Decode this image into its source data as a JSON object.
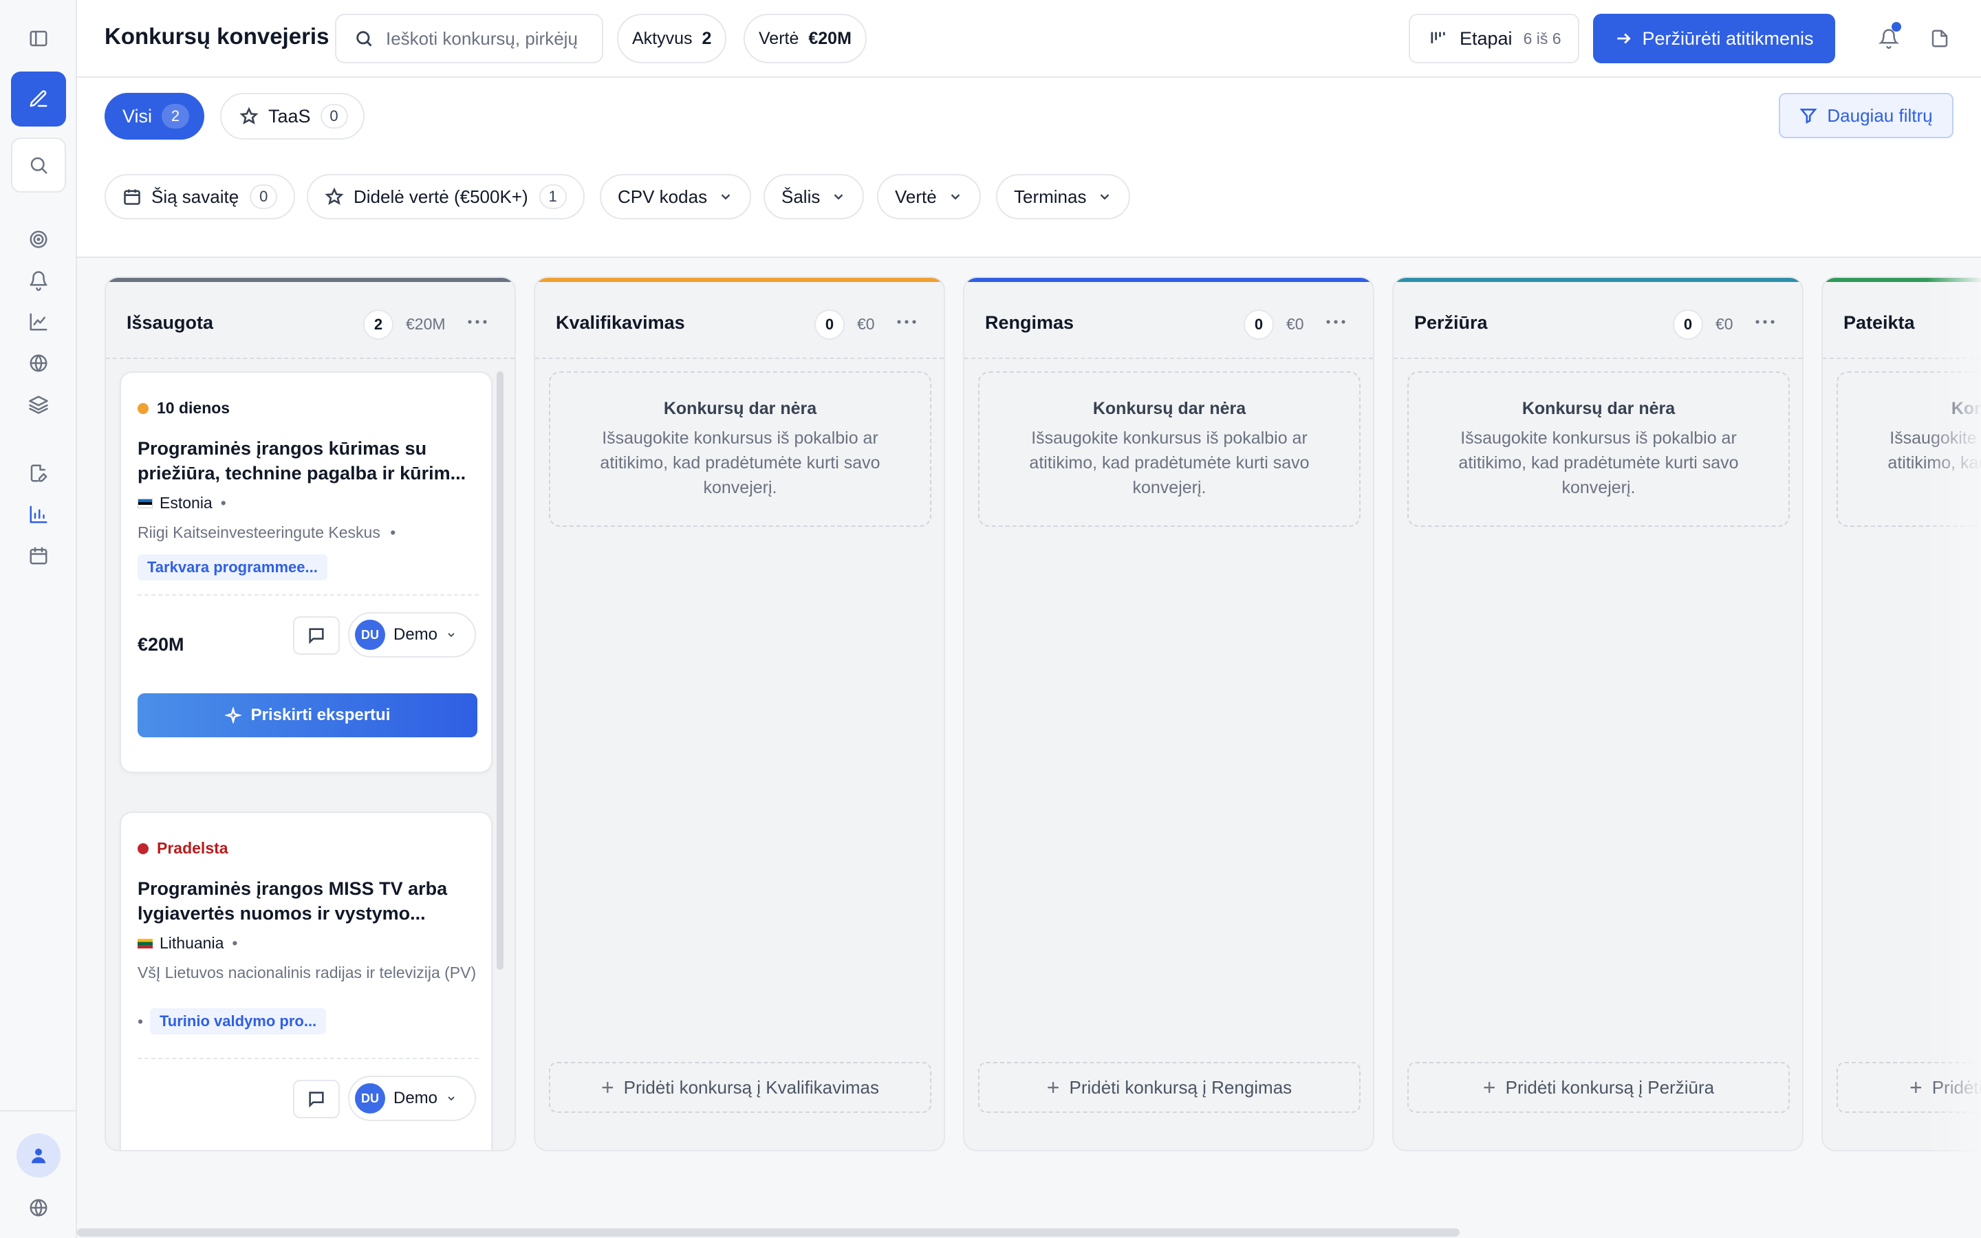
{
  "header": {
    "title": "Konkursų konvejeris",
    "search_placeholder": "Ieškoti konkursų, pirkėjų",
    "active_label": "Aktyvus",
    "active_count": "2",
    "value_label": "Vertė",
    "value_amount": "€20M",
    "stages_label": "Etapai",
    "stages_sub": "6 iš 6",
    "view_matches_label": "Peržiūrėti atitikmenis"
  },
  "tabs": [
    {
      "label": "Visi",
      "count": "2"
    },
    {
      "label": "TaaS",
      "count": "0"
    }
  ],
  "more_filters_label": "Daugiau filtrų",
  "chips": [
    {
      "label": "Šią savaitę",
      "count": "0"
    },
    {
      "label": "Didelė vertė (€500K+)",
      "count": "1"
    },
    {
      "label": "CPV kodas"
    },
    {
      "label": "Šalis"
    },
    {
      "label": "Vertė"
    },
    {
      "label": "Terminas"
    }
  ],
  "empty_state": {
    "title": "Konkursų dar nėra",
    "desc": "Išsaugokite konkursus iš pokalbio ar atitikimo, kad pradėtumėte kurti savo konvejerį."
  },
  "columns": [
    {
      "title": "Išsaugota",
      "count": "2",
      "value": "€20M",
      "color": "#6b7280"
    },
    {
      "title": "Kvalifikavimas",
      "count": "0",
      "value": "€0",
      "color": "#f0a030",
      "add": "Pridėti konkursą į Kvalifikavimas"
    },
    {
      "title": "Rengimas",
      "count": "0",
      "value": "€0",
      "color": "#2f5fe3",
      "add": "Pridėti konkursą į Rengimas"
    },
    {
      "title": "Peržiūra",
      "count": "0",
      "value": "€0",
      "color": "#2f8fa8",
      "add": "Pridėti konkursą į Peržiūra"
    },
    {
      "title": "Pateikta",
      "color": "#2f9a5a",
      "add": "Pridėti"
    }
  ],
  "cards": [
    {
      "status": "10 dienos",
      "status_color": "#f0a030",
      "title": "Programinės įrangos kūrimas su priežiūra, technine pagalba ir kūrim...",
      "country": "Estonia",
      "buyer": "Riigi Kaitseinvesteeringute Keskus",
      "tag": "Tarkvara programmee...",
      "value": "€20M",
      "assignee_initials": "DU",
      "assignee_name": "Demo",
      "assign_label": "Priskirti ekspertui"
    },
    {
      "status": "Pradelsta",
      "status_color": "#c0262d",
      "title": "Programinės įrangos MISS TV arba lygiavertės nuomos ir vystymo...",
      "country": "Lithuania",
      "buyer": "VšĮ Lietuvos nacionalinis radijas ir televizija (PV)",
      "tag": "Turinio valdymo pro...",
      "assignee_initials": "DU",
      "assignee_name": "Demo"
    }
  ],
  "colors": {
    "accent": "#2f5fe3"
  }
}
